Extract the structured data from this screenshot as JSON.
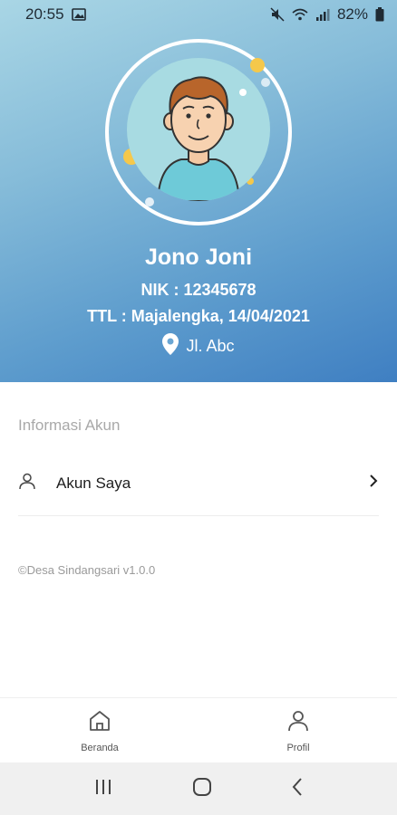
{
  "status_bar": {
    "time": "20:55",
    "battery": "82%"
  },
  "profile": {
    "name": "Jono Joni",
    "nik": "NIK : 12345678",
    "ttl": "TTL : Majalengka, 14/04/2021",
    "address": "Jl. Abc"
  },
  "section": {
    "title": "Informasi Akun"
  },
  "menu": {
    "account_label": "Akun Saya"
  },
  "footer": {
    "version": "©Desa Sindangsari v1.0.0"
  },
  "bottom_nav": {
    "items": [
      {
        "label": "Beranda",
        "icon": "home-icon"
      },
      {
        "label": "Profil",
        "icon": "user-icon"
      }
    ]
  },
  "colors": {
    "header_top": "#a9d6e5",
    "header_bottom": "#3f7fc2",
    "avatar_bg": "#a8dbe2",
    "accent_yellow": "#f5c84b"
  }
}
